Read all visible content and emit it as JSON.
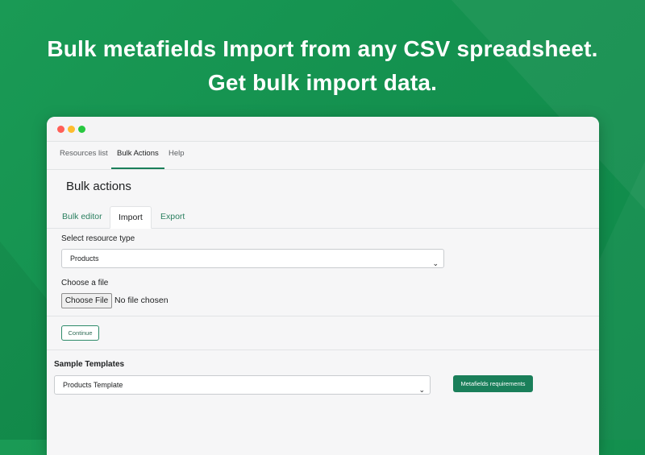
{
  "headline": {
    "line1": "Bulk metafields Import from any CSV spreadsheet.",
    "line2": "Get bulk import data."
  },
  "nav": {
    "items": [
      {
        "label": "Resources list",
        "active": false
      },
      {
        "label": "Bulk Actions",
        "active": true
      },
      {
        "label": "Help",
        "active": false
      }
    ]
  },
  "page": {
    "title": "Bulk actions",
    "tabs": [
      {
        "label": "Bulk editor",
        "active": false
      },
      {
        "label": "Import",
        "active": true
      },
      {
        "label": "Export",
        "active": false
      }
    ]
  },
  "form": {
    "resource_label": "Select resource type",
    "resource_value": "Products",
    "file_label": "Choose a file",
    "file_button": "Choose File",
    "file_status": "No file chosen",
    "continue_label": "Continue"
  },
  "samples": {
    "title": "Sample Templates",
    "template_value": "Products Template",
    "requirements_label": "Metafields requirements"
  },
  "colors": {
    "background": "#14914f",
    "accent": "#1a7f5a",
    "window": "#f6f6f7"
  }
}
